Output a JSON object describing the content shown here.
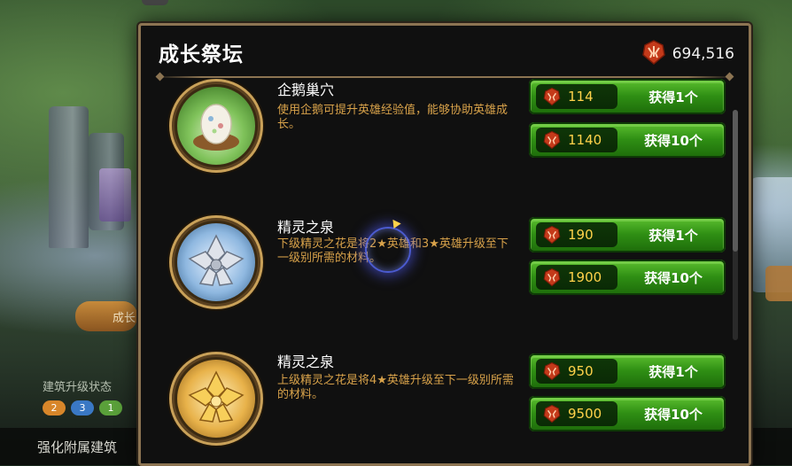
{
  "background": {
    "left_tab_label": "成长",
    "status_label": "建筑升级状态",
    "badges": [
      {
        "text": "2",
        "color": "#d8862a"
      },
      {
        "text": "3",
        "color": "#3a78c4"
      },
      {
        "text": "1",
        "color": "#5aa03a"
      }
    ],
    "bottom_label": "强化附属建筑"
  },
  "modal": {
    "title": "成长祭坛",
    "currency_icon": "red-crest-token-icon",
    "currency_amount": "694,516"
  },
  "items": [
    {
      "name": "企鹅巢穴",
      "desc": "使用企鹅可提升英雄经验值，能够协助英雄成长。",
      "icon": "egg-nest-icon",
      "buttons": [
        {
          "price": "114",
          "label": "获得1个"
        },
        {
          "price": "1140",
          "label": "获得10个"
        }
      ]
    },
    {
      "name": "精灵之泉",
      "desc": "下级精灵之花是将2★英雄和3★英雄升级至下一级别所需的材料。",
      "icon": "silver-flower-icon",
      "buttons": [
        {
          "price": "190",
          "label": "获得1个"
        },
        {
          "price": "1900",
          "label": "获得10个"
        }
      ]
    },
    {
      "name": "精灵之泉",
      "desc": "上级精灵之花是将4★英雄升级至下一级别所需的材料。",
      "icon": "gold-flower-icon",
      "buttons": [
        {
          "price": "950",
          "label": "获得1个"
        },
        {
          "price": "9500",
          "label": "获得10个"
        }
      ]
    }
  ],
  "colors": {
    "frame": "#8c7452",
    "button_green": "#2f8f14",
    "price_yellow": "#ffd24a",
    "desc_orange": "#d8a24a"
  }
}
